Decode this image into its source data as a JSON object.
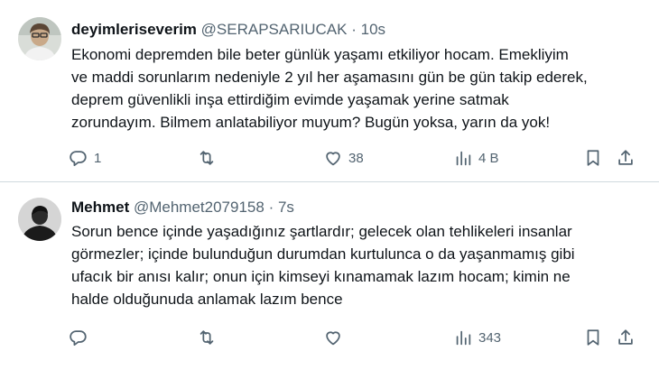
{
  "tweets": [
    {
      "name": "deyimleriseverim",
      "handle": "@SERAPSARIUCAK",
      "separator": "·",
      "time": "10s",
      "lines": [
        "Ekonomi depremden bile beter günlük yaşamı etkiliyor hocam. Emekliyim",
        "ve maddi sorunlarım nedeniyle 2 yıl her aşamasını gün be gün takip ederek,",
        "deprem güvenlikli inşa ettirdiğim evimde yaşamak yerine satmak",
        "zorundayım. Bilmem anlatabiliyor muyum? Bugün yoksa, yarın da yok!"
      ],
      "replies": "1",
      "retweets": "",
      "likes": "38",
      "views": "4 B"
    },
    {
      "name": "Mehmet",
      "handle": "@Mehmet2079158",
      "separator": "·",
      "time": "7s",
      "lines": [
        "Sorun bence içinde yaşadığınız şartlardır; gelecek olan tehlikeleri insanlar",
        "görmezler; içinde bulunduğun durumdan kurtulunca o da yaşanmamış gibi",
        "ufacık bir anısı kalır; onun için kimseyi kınamamak lazım hocam; kimin ne",
        "halde olduğunuda anlamak lazım bence"
      ],
      "replies": "",
      "retweets": "",
      "likes": "",
      "views": "343"
    }
  ],
  "icons": {
    "reply": "reply-icon",
    "retweet": "retweet-icon",
    "like": "heart-icon",
    "views": "views-icon",
    "bookmark": "bookmark-icon",
    "share": "share-icon"
  },
  "colors": {
    "text": "#0f1419",
    "secondary": "#536471",
    "border": "#cfd9de"
  }
}
